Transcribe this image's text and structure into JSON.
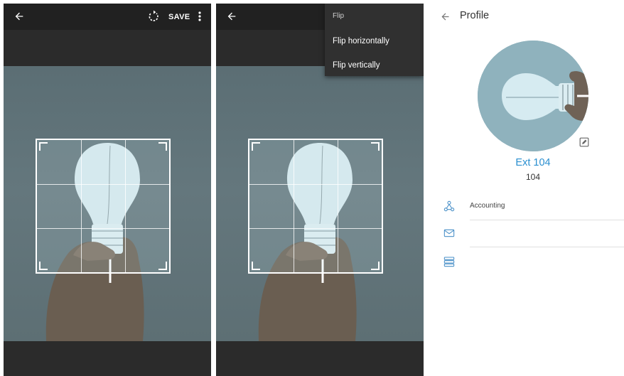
{
  "editor": {
    "save_label": "SAVE"
  },
  "flip_menu": {
    "title": "Flip",
    "items": [
      {
        "label": "Flip horizontally"
      },
      {
        "label": "Flip vertically"
      }
    ]
  },
  "profile": {
    "title": "Profile",
    "name": "Ext 104",
    "extension": "104",
    "department": "Accounting",
    "email": "",
    "server": ""
  },
  "colors": {
    "accent": "#2a8fd0",
    "icon_blue": "#4a90c8",
    "toolbar": "#212121",
    "editor_bg": "#2b2b2b"
  },
  "icons": {
    "back": "arrow-left-icon",
    "rotate": "rotate-icon",
    "more": "more-vert-icon",
    "edit": "edit-icon",
    "department": "org-chart-icon",
    "email": "mail-icon",
    "server": "server-icon"
  }
}
